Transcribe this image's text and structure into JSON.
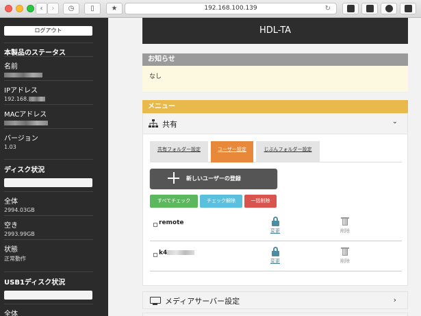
{
  "browser": {
    "url": "192.168.100.139",
    "back_icon": "‹",
    "forward_icon": "›",
    "history_icon": "◷",
    "sidebar_icon": "▯",
    "bookmark_icon": "★",
    "reload_icon": "↻"
  },
  "sidebar": {
    "logout_label": "ログアウト",
    "status_heading": "本製品のステータス",
    "name_label": "名前",
    "ip_label": "IPアドレス",
    "ip_value": "192.168.",
    "mac_label": "MACアドレス",
    "version_label": "バージョン",
    "version_value": "1.03",
    "disk_heading": "ディスク状況",
    "total_label": "全体",
    "total_value": "2994.03GB",
    "free_label": "空き",
    "free_value": "2993.99GB",
    "state_label": "状態",
    "state_value": "正常動作",
    "usb_heading": "USB1ディスク状況",
    "usb_total_label": "全体"
  },
  "main": {
    "device_title": "HDL-TA",
    "notice_heading": "お知らせ",
    "notice_text": "なし",
    "menu_heading": "メニュー",
    "share_title": "共有",
    "share_chevron": "⌄",
    "tabs": [
      {
        "label": "共有フォルダー設定"
      },
      {
        "label": "ユーザー設定"
      },
      {
        "label": "じぶんフォルダー設定"
      }
    ],
    "new_user_label": "新しいユーザーの登録",
    "check_all_label": "すべてチェック",
    "uncheck_label": "チェック解除",
    "bulk_delete_label": "一括削除",
    "users": [
      {
        "name": "remote",
        "edit_label": "変更",
        "delete_label": "削除"
      },
      {
        "name": "k4",
        "edit_label": "変更",
        "delete_label": "削除"
      }
    ],
    "media_server_label": "メディアサーバー設定",
    "media_chevron": "›"
  },
  "colors": {
    "sidebar_bg": "#2b2b2b",
    "header_bg": "#2d2d2d",
    "notice_head_bg": "#9a9a9a",
    "notice_body_bg": "#fdf8e0",
    "menu_head_bg": "#e9b94b",
    "active_tab_bg": "#e8883a",
    "check_all_bg": "#5cb85c",
    "uncheck_bg": "#5bc0de",
    "bulk_delete_bg": "#d9534f",
    "lock_color": "#4b8ea3"
  }
}
